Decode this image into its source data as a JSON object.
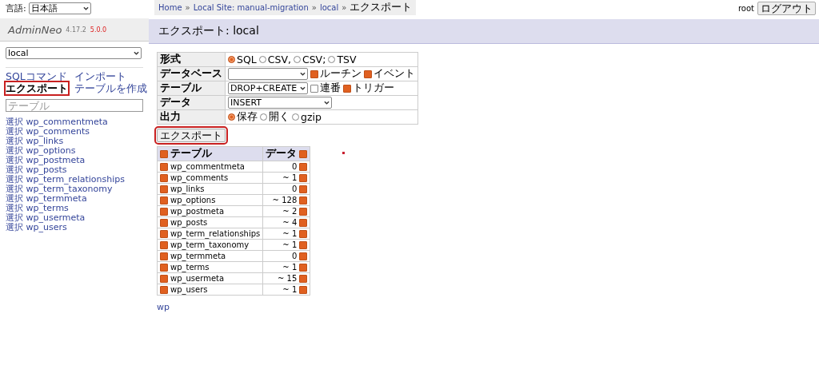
{
  "language": {
    "label": "言語:",
    "value": "日本語"
  },
  "logo": {
    "name": "AdminNeo",
    "version": "4.17.2",
    "new_version": "5.0.0"
  },
  "database_select": "local",
  "links": [
    {
      "label": "SQLコマンド",
      "selected": false,
      "highlighted": false
    },
    {
      "label": "インポート",
      "selected": false,
      "highlighted": false
    },
    {
      "label": "エクスポート",
      "selected": true,
      "highlighted": true
    },
    {
      "label": "テーブルを作成",
      "selected": false,
      "highlighted": false
    }
  ],
  "filter": {
    "placeholder": "テーブル"
  },
  "tables": [
    {
      "action": "選択",
      "name": "wp_commentmeta"
    },
    {
      "action": "選択",
      "name": "wp_comments"
    },
    {
      "action": "選択",
      "name": "wp_links"
    },
    {
      "action": "選択",
      "name": "wp_options"
    },
    {
      "action": "選択",
      "name": "wp_postmeta"
    },
    {
      "action": "選択",
      "name": "wp_posts"
    },
    {
      "action": "選択",
      "name": "wp_term_relationships"
    },
    {
      "action": "選択",
      "name": "wp_term_taxonomy"
    },
    {
      "action": "選択",
      "name": "wp_termmeta"
    },
    {
      "action": "選択",
      "name": "wp_terms"
    },
    {
      "action": "選択",
      "name": "wp_usermeta"
    },
    {
      "action": "選択",
      "name": "wp_users"
    }
  ],
  "breadcrumb": {
    "separator": "»",
    "items": [
      {
        "label": "Home",
        "kind": "link"
      },
      {
        "label": "Local Site: manual-migration",
        "kind": "link"
      },
      {
        "label": "local",
        "kind": "link"
      },
      {
        "label": "エクスポート",
        "kind": "text"
      }
    ]
  },
  "user": {
    "name": "root",
    "logout": "ログアウト"
  },
  "heading": "エクスポート: local",
  "form": [
    {
      "label": "形式",
      "kind": "radio",
      "options": [
        {
          "label": "SQL",
          "selected": true
        },
        {
          "label": "CSV,",
          "selected": false
        },
        {
          "label": "CSV;",
          "selected": false
        },
        {
          "label": "TSV",
          "selected": false
        }
      ]
    },
    {
      "label": "データベース",
      "kind": "select-checks",
      "checks": [
        {
          "label": "ルーチン",
          "checked": true
        },
        {
          "label": "イベント",
          "checked": true
        }
      ]
    },
    {
      "label": "テーブル",
      "kind": "select-checks",
      "select": "DROP+CREATE",
      "checks": [
        {
          "label": "連番",
          "checked": false
        },
        {
          "label": "トリガー",
          "checked": true
        }
      ]
    },
    {
      "label": "データ",
      "kind": "select",
      "select": "INSERT"
    },
    {
      "label": "出力",
      "kind": "radio",
      "options": [
        {
          "label": "保存",
          "selected": true
        },
        {
          "label": "開く",
          "selected": false
        },
        {
          "label": "gzip",
          "selected": false
        }
      ]
    }
  ],
  "export_button": {
    "label": "エクスポート",
    "highlighted": true
  },
  "table": {
    "columns": [
      {
        "label": "テーブル",
        "checked": true
      },
      {
        "label": "データ",
        "checked": true
      }
    ],
    "rows": [
      {
        "name": "wp_commentmeta",
        "count": "0",
        "checked": true,
        "data_checked": true
      },
      {
        "name": "wp_comments",
        "count": "~ 1",
        "checked": true,
        "data_checked": true
      },
      {
        "name": "wp_links",
        "count": "0",
        "checked": true,
        "data_checked": true
      },
      {
        "name": "wp_options",
        "count": "~ 128",
        "checked": true,
        "data_checked": true
      },
      {
        "name": "wp_postmeta",
        "count": "~ 2",
        "checked": true,
        "data_checked": true
      },
      {
        "name": "wp_posts",
        "count": "~ 4",
        "checked": true,
        "data_checked": true
      },
      {
        "name": "wp_term_relationships",
        "count": "~ 1",
        "checked": true,
        "data_checked": true
      },
      {
        "name": "wp_term_taxonomy",
        "count": "~ 1",
        "checked": true,
        "data_checked": true
      },
      {
        "name": "wp_termmeta",
        "count": "0",
        "checked": true,
        "data_checked": true
      },
      {
        "name": "wp_terms",
        "count": "~ 1",
        "checked": true,
        "data_checked": true
      },
      {
        "name": "wp_usermeta",
        "count": "~ 15",
        "checked": true,
        "data_checked": true
      },
      {
        "name": "wp_users",
        "count": "~ 1",
        "checked": true,
        "data_checked": true
      }
    ]
  },
  "footer_link": "wp"
}
